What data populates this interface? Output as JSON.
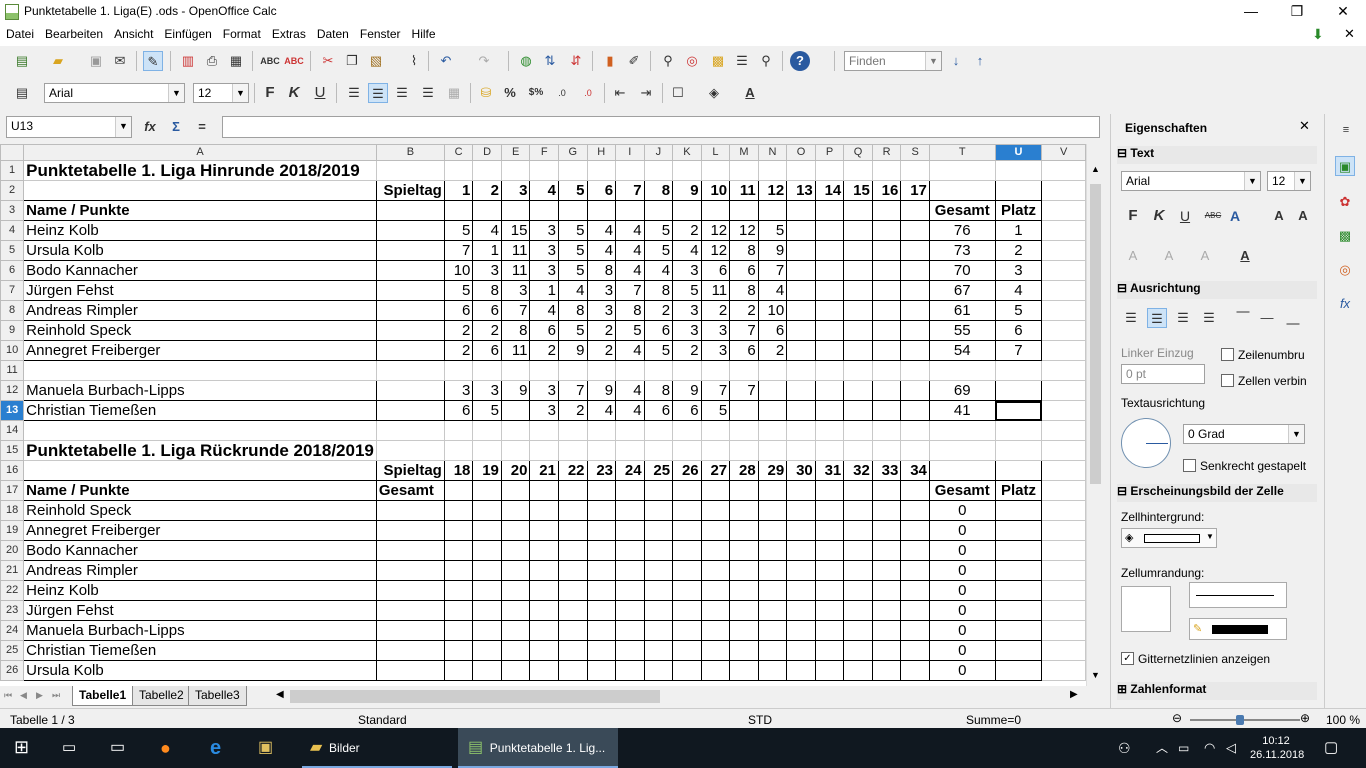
{
  "window": {
    "title": "Punktetabelle 1. Liga(E) .ods - OpenOffice Calc",
    "minimize": "—",
    "maximize": "❐",
    "close": "✕"
  },
  "menu": [
    "Datei",
    "Bearbeiten",
    "Ansicht",
    "Einfügen",
    "Format",
    "Extras",
    "Daten",
    "Fenster",
    "Hilfe"
  ],
  "toolbar": {
    "find_placeholder": "Finden",
    "font_name": "Arial",
    "font_size": "12"
  },
  "formula": {
    "cell_ref": "U13",
    "fx": "fx",
    "sum": "Σ",
    "eq": "="
  },
  "columns": [
    "A",
    "B",
    "C",
    "D",
    "E",
    "F",
    "G",
    "H",
    "I",
    "J",
    "K",
    "L",
    "M",
    "N",
    "O",
    "P",
    "Q",
    "R",
    "S",
    "T",
    "U",
    "V"
  ],
  "rows": [
    {
      "n": "1",
      "cells": {
        "A": "Punktetabelle 1. Liga Hinrunde 2018/2019"
      },
      "title": true
    },
    {
      "n": "2",
      "cells": {
        "B": "Spieltag",
        "C": "1",
        "D": "2",
        "E": "3",
        "F": "4",
        "G": "5",
        "H": "6",
        "I": "7",
        "J": "8",
        "K": "9",
        "L": "10",
        "M": "11",
        "N": "12",
        "O": "13",
        "P": "14",
        "Q": "15",
        "R": "16",
        "S": "17"
      },
      "bold": true
    },
    {
      "n": "3",
      "cells": {
        "A": "Name / Punkte",
        "T": "Gesamt",
        "U": "Platz"
      },
      "bold": true
    },
    {
      "n": "4",
      "cells": {
        "A": "Heinz Kolb",
        "C": "5",
        "D": "4",
        "E": "15",
        "F": "3",
        "G": "5",
        "H": "4",
        "I": "4",
        "J": "5",
        "K": "2",
        "L": "12",
        "M": "12",
        "N": "5",
        "T": "76",
        "U": "1"
      }
    },
    {
      "n": "5",
      "cells": {
        "A": "Ursula Kolb",
        "C": "7",
        "D": "1",
        "E": "11",
        "F": "3",
        "G": "5",
        "H": "4",
        "I": "4",
        "J": "5",
        "K": "4",
        "L": "12",
        "M": "8",
        "N": "9",
        "T": "73",
        "U": "2"
      }
    },
    {
      "n": "6",
      "cells": {
        "A": "Bodo Kannacher",
        "C": "10",
        "D": "3",
        "E": "11",
        "F": "3",
        "G": "5",
        "H": "8",
        "I": "4",
        "J": "4",
        "K": "3",
        "L": "6",
        "M": "6",
        "N": "7",
        "T": "70",
        "U": "3"
      }
    },
    {
      "n": "7",
      "cells": {
        "A": "Jürgen Fehst",
        "C": "5",
        "D": "8",
        "E": "3",
        "F": "1",
        "G": "4",
        "H": "3",
        "I": "7",
        "J": "8",
        "K": "5",
        "L": "11",
        "M": "8",
        "N": "4",
        "T": "67",
        "U": "4"
      }
    },
    {
      "n": "8",
      "cells": {
        "A": "Andreas Rimpler",
        "C": "6",
        "D": "6",
        "E": "7",
        "F": "4",
        "G": "8",
        "H": "3",
        "I": "8",
        "J": "2",
        "K": "3",
        "L": "2",
        "M": "2",
        "N": "10",
        "T": "61",
        "U": "5"
      }
    },
    {
      "n": "9",
      "cells": {
        "A": "Reinhold Speck",
        "C": "2",
        "D": "2",
        "E": "8",
        "F": "6",
        "G": "5",
        "H": "2",
        "I": "5",
        "J": "6",
        "K": "3",
        "L": "3",
        "M": "7",
        "N": "6",
        "T": "55",
        "U": "6"
      }
    },
    {
      "n": "10",
      "cells": {
        "A": "Annegret Freiberger",
        "C": "2",
        "D": "6",
        "E": "11",
        "F": "2",
        "G": "9",
        "H": "2",
        "I": "4",
        "J": "5",
        "K": "2",
        "L": "3",
        "M": "6",
        "N": "2",
        "T": "54",
        "U": "7"
      }
    },
    {
      "n": "11",
      "cells": {}
    },
    {
      "n": "12",
      "cells": {
        "A": "Manuela Burbach-Lipps",
        "C": "3",
        "D": "3",
        "E": "9",
        "F": "3",
        "G": "7",
        "H": "9",
        "I": "4",
        "J": "8",
        "K": "9",
        "L": "7",
        "M": "7",
        "T": "69"
      }
    },
    {
      "n": "13",
      "cells": {
        "A": "Christian Tiemeßen",
        "C": "6",
        "D": "5",
        "F": "3",
        "G": "2",
        "H": "4",
        "I": "4",
        "J": "6",
        "K": "6",
        "L": "5",
        "T": "41"
      }
    },
    {
      "n": "14",
      "cells": {}
    },
    {
      "n": "15",
      "cells": {
        "A": "Punktetabelle 1. Liga Rückrunde 2018/2019"
      },
      "title": true
    },
    {
      "n": "16",
      "cells": {
        "B": "Spieltag",
        "C": "18",
        "D": "19",
        "E": "20",
        "F": "21",
        "G": "22",
        "H": "23",
        "I": "24",
        "J": "25",
        "K": "26",
        "L": "27",
        "M": "28",
        "N": "29",
        "O": "30",
        "P": "31",
        "Q": "32",
        "R": "33",
        "S": "34"
      },
      "bold": true
    },
    {
      "n": "17",
      "cells": {
        "A": "Name / Punkte",
        "B": "Gesamt",
        "T": "Gesamt",
        "U": "Platz"
      },
      "bold": true
    },
    {
      "n": "18",
      "cells": {
        "A": "Reinhold Speck",
        "T": "0"
      }
    },
    {
      "n": "19",
      "cells": {
        "A": "Annegret Freiberger",
        "T": "0"
      }
    },
    {
      "n": "20",
      "cells": {
        "A": "Bodo Kannacher",
        "T": "0"
      }
    },
    {
      "n": "21",
      "cells": {
        "A": "Andreas Rimpler",
        "T": "0"
      }
    },
    {
      "n": "22",
      "cells": {
        "A": "Heinz Kolb",
        "T": "0"
      }
    },
    {
      "n": "23",
      "cells": {
        "A": "Jürgen Fehst",
        "T": "0"
      }
    },
    {
      "n": "24",
      "cells": {
        "A": "Manuela Burbach-Lipps",
        "T": "0"
      }
    },
    {
      "n": "25",
      "cells": {
        "A": "Christian Tiemeßen",
        "T": "0"
      }
    },
    {
      "n": "26",
      "cells": {
        "A": "Ursula Kolb",
        "T": "0"
      }
    }
  ],
  "sheet_tabs": [
    "Tabelle1",
    "Tabelle2",
    "Tabelle3"
  ],
  "status": {
    "sheet": "Tabelle 1 / 3",
    "style": "Standard",
    "mode": "STD",
    "sum": "Summe=0",
    "zoom": "100 %"
  },
  "sidebar": {
    "title": "Eigenschaften",
    "text_section": "Text",
    "font": "Arial",
    "size": "12",
    "align_section": "Ausrichtung",
    "indent_label": "Linker Einzug",
    "indent_value": "0 pt",
    "wrap": "Zeilenumbru",
    "merge": "Zellen verbin",
    "orientation_label": "Textausrichtung",
    "angle": "0 Grad",
    "vertical": "Senkrecht gestapelt",
    "appearance_section": "Erscheinungsbild der Zelle",
    "bg_label": "Zellhintergrund:",
    "border_label": "Zellumrandung:",
    "gridlines": "Gitternetzlinien anzeigen",
    "number_section": "Zahlenformat"
  },
  "taskbar": {
    "bilder": "Bilder",
    "calc": "Punktetabelle 1. Lig...",
    "time": "10:12",
    "date": "26.11.2018"
  }
}
